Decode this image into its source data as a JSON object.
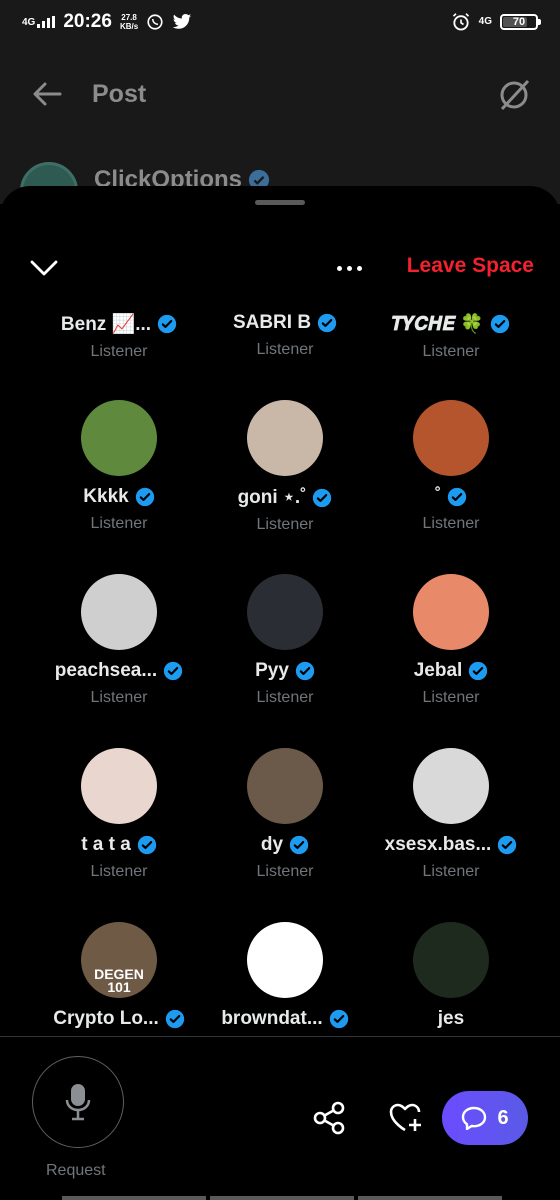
{
  "status_bar": {
    "network_left": "4G",
    "time": "20:26",
    "speed_value": "27.8",
    "speed_unit": "KB/s",
    "network_right": "4G",
    "battery": "70"
  },
  "background_post": {
    "title": "Post",
    "author": "ClickOptions"
  },
  "space": {
    "leave_label": "Leave Space",
    "participants": [
      {
        "name": "Benz 📈...",
        "role": "Listener",
        "verified": true,
        "avatar_color": "#3a3a3a"
      },
      {
        "name": "SABRI B",
        "role": "Listener",
        "verified": true,
        "avatar_color": "#3a3a3a"
      },
      {
        "name": "𝑻𝒀𝑪𝑯𝑬 🍀",
        "role": "Listener",
        "verified": true,
        "avatar_color": "#3a3a3a"
      },
      {
        "name": "Kkkk",
        "role": "Listener",
        "verified": true,
        "avatar_color": "#5f8a3e"
      },
      {
        "name": "goni ⋆.˚",
        "role": "Listener",
        "verified": true,
        "avatar_color": "#c9b8a8"
      },
      {
        "name": "˚",
        "role": "Listener",
        "verified": true,
        "avatar_color": "#b5552e"
      },
      {
        "name": "peachsea...",
        "role": "Listener",
        "verified": true,
        "avatar_color": "#cfcfcf"
      },
      {
        "name": "Pyy",
        "role": "Listener",
        "verified": true,
        "avatar_color": "#2a2d33"
      },
      {
        "name": "Jebal",
        "role": "Listener",
        "verified": true,
        "avatar_color": "#e88a6a"
      },
      {
        "name": "t a t a",
        "role": "Listener",
        "verified": true,
        "avatar_color": "#e9d6cf"
      },
      {
        "name": "dy",
        "role": "Listener",
        "verified": true,
        "avatar_color": "#6b5a4a"
      },
      {
        "name": "xsesx.bas...",
        "role": "Listener",
        "verified": true,
        "avatar_color": "#d9d9d9"
      },
      {
        "name": "Crypto Lo...",
        "role": "",
        "verified": true,
        "avatar_color": "#6e5a45"
      },
      {
        "name": "browndat...",
        "role": "",
        "verified": true,
        "avatar_color": "#ffffff"
      },
      {
        "name": "jes",
        "role": "",
        "verified": false,
        "avatar_color": "#1f2a1f"
      }
    ],
    "degen_text_1": "DEGEN",
    "degen_text_2": "101"
  },
  "bottom": {
    "request_label": "Request",
    "comments_count": "6"
  },
  "colors": {
    "verified": "#1d9bf0",
    "leave": "#f4212e",
    "comments": "#6b4cff"
  }
}
